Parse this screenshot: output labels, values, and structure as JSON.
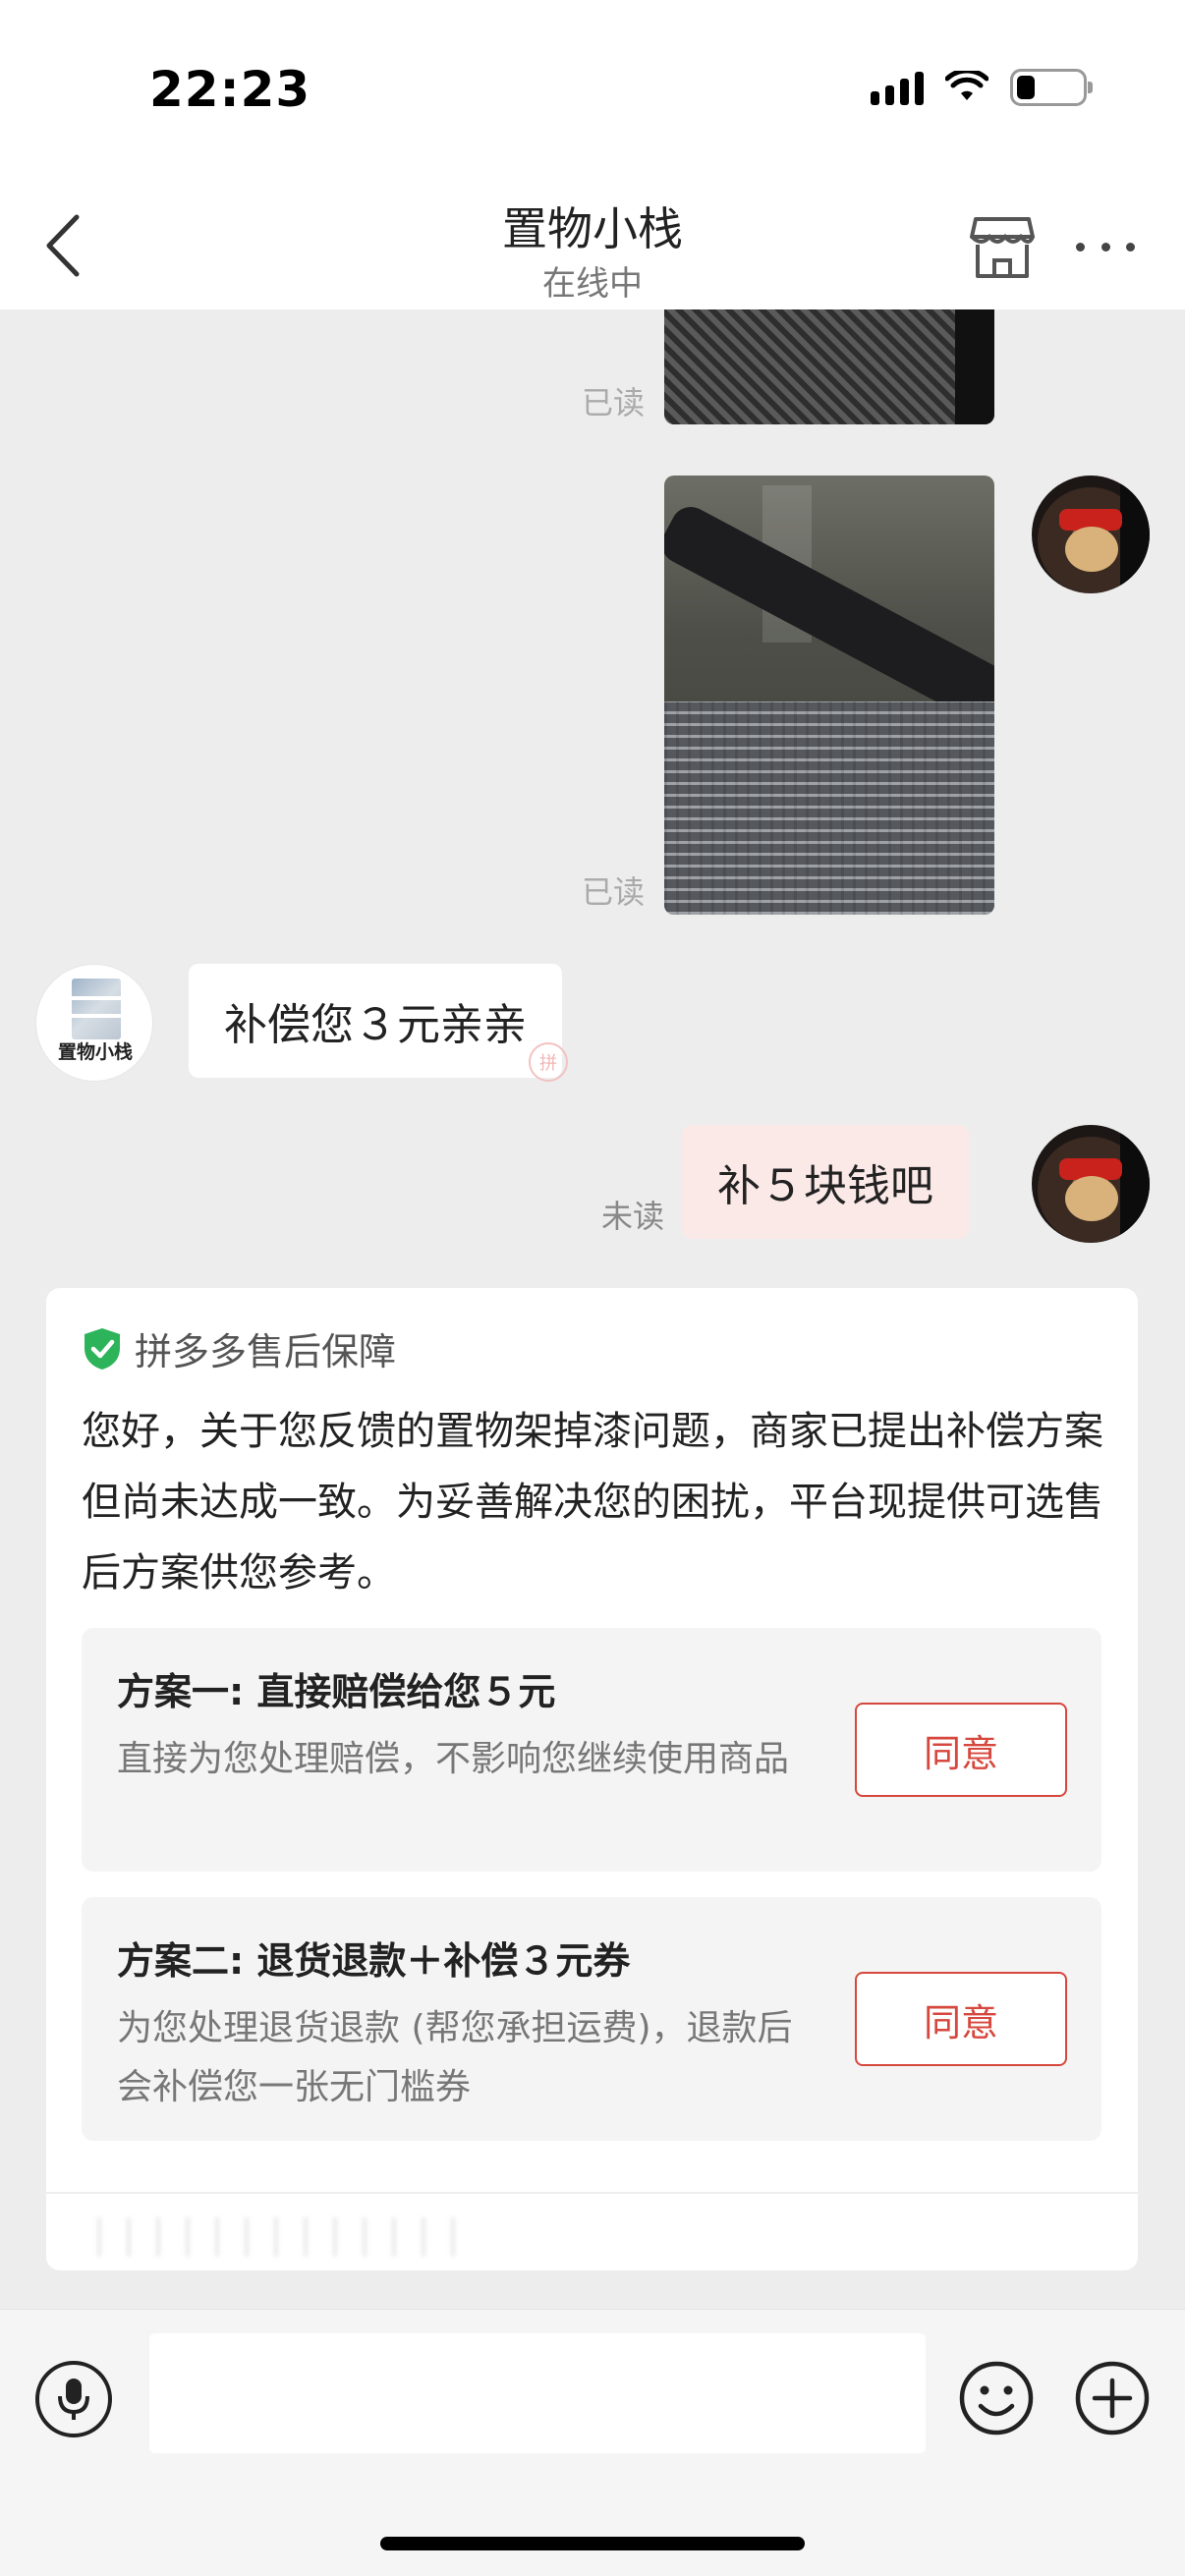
{
  "status_bar": {
    "time": "22:23"
  },
  "nav": {
    "title": "置物小栈",
    "subtitle": "在线中",
    "back_icon": "chevron-left-icon",
    "store_icon": "store-icon",
    "more_icon": "more-icon"
  },
  "messages": [
    {
      "type": "image",
      "side": "right",
      "status": "已读"
    },
    {
      "type": "image",
      "side": "right",
      "status": "已读"
    },
    {
      "type": "text",
      "side": "left",
      "text": "补偿您３元亲亲",
      "sender": "置物小栈"
    },
    {
      "type": "text",
      "side": "right",
      "text": "补５块钱吧",
      "status": "未读"
    }
  ],
  "shop_avatar_label": "置物小栈",
  "card": {
    "header": "拼多多售后保障",
    "body": "您好，关于您反馈的置物架掉漆问题，商家已提出补偿方案但尚未达成一致。为妥善解决您的困扰，平台现提供可选售后方案供您参考。",
    "options": [
      {
        "title": "方案一: 直接赔偿给您５元",
        "desc": "直接为您处理赔偿，不影响您继续使用商品",
        "button": "同意"
      },
      {
        "title": "方案二: 退货退款＋补偿３元券",
        "desc": "为您处理退货退款 (帮您承担运费)，退款后会补偿您一张无门槛券",
        "button": "同意"
      }
    ]
  },
  "input_bar": {
    "placeholder": "",
    "voice_icon": "microphone-icon",
    "emoji_icon": "emoji-icon",
    "plus_icon": "plus-icon"
  },
  "colors": {
    "accent_red": "#d6473d",
    "shield_green": "#2db45a",
    "right_bubble": "#fbe9e8"
  }
}
